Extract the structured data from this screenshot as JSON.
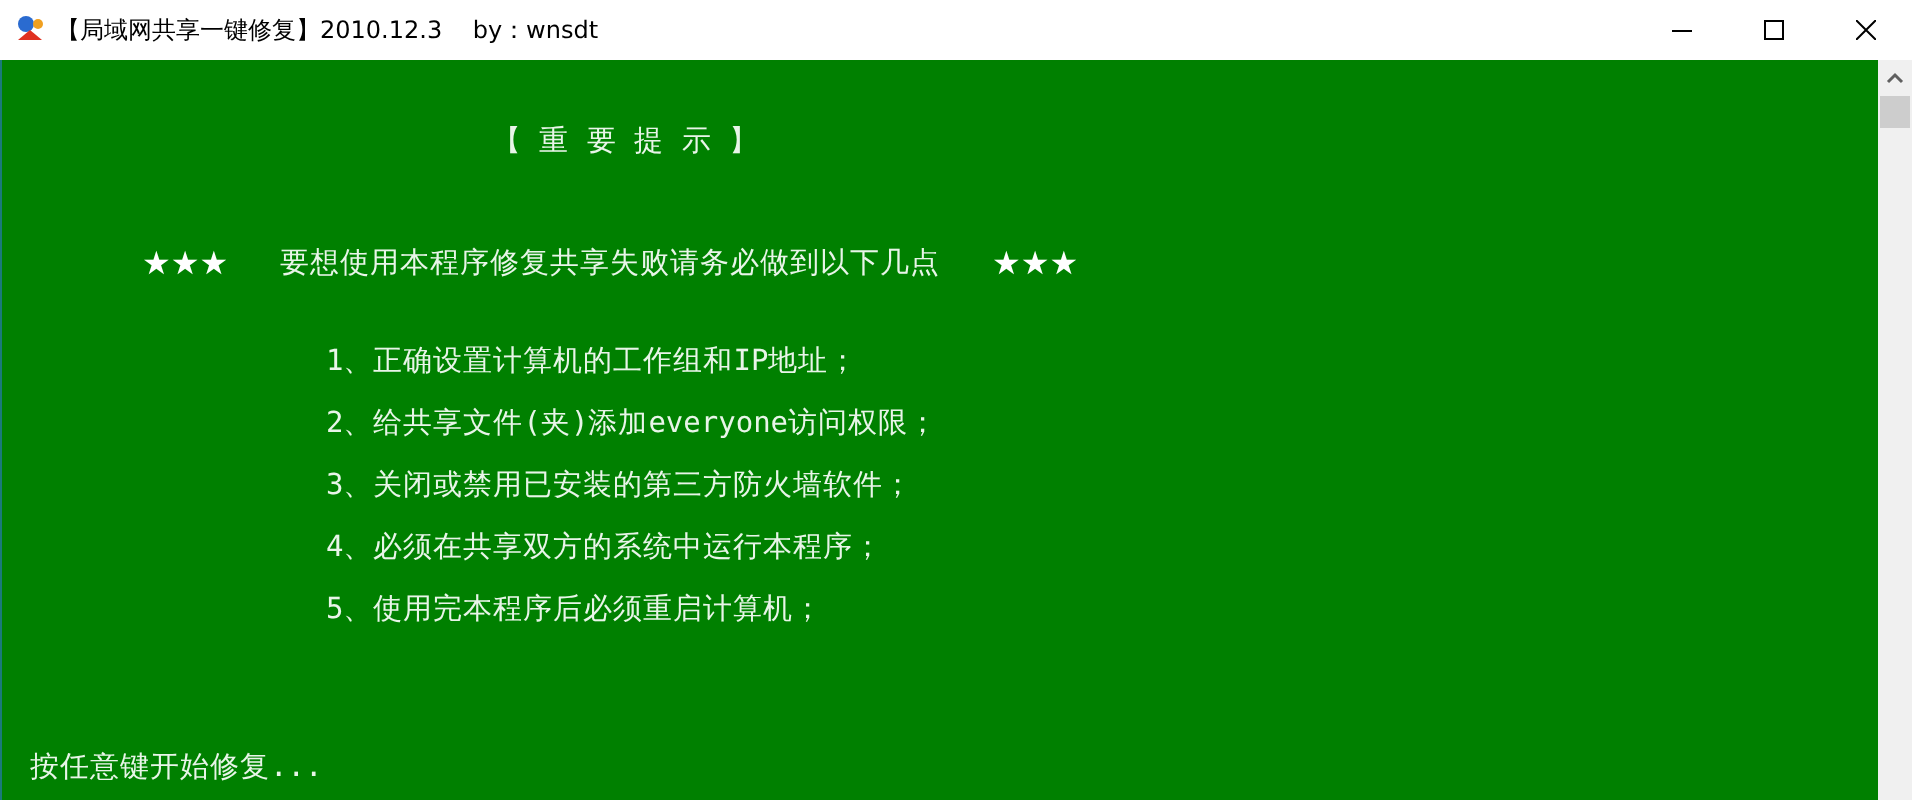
{
  "window": {
    "title": "【局域网共享一键修复】2010.12.3    by：wnsdt"
  },
  "console": {
    "lines": [
      {
        "kind": "heading",
        "text": "【 重 要 提 示 】"
      },
      {
        "kind": "banner",
        "left": "★★★",
        "text": "要想使用本程序修复共享失败请务必做到以下几点",
        "right": "★★★"
      },
      {
        "kind": "item",
        "text": "1、正确设置计算机的工作组和IP地址；"
      },
      {
        "kind": "item",
        "text": "2、给共享文件(夹)添加everyone访问权限；"
      },
      {
        "kind": "item",
        "text": "3、关闭或禁用已安装的第三方防火墙软件；"
      },
      {
        "kind": "item",
        "text": "4、必须在共享双方的系统中运行本程序；"
      },
      {
        "kind": "item",
        "text": "5、使用完本程序后必须重启计算机；"
      },
      {
        "kind": "prompt",
        "text": "按任意键开始修复..."
      }
    ]
  }
}
